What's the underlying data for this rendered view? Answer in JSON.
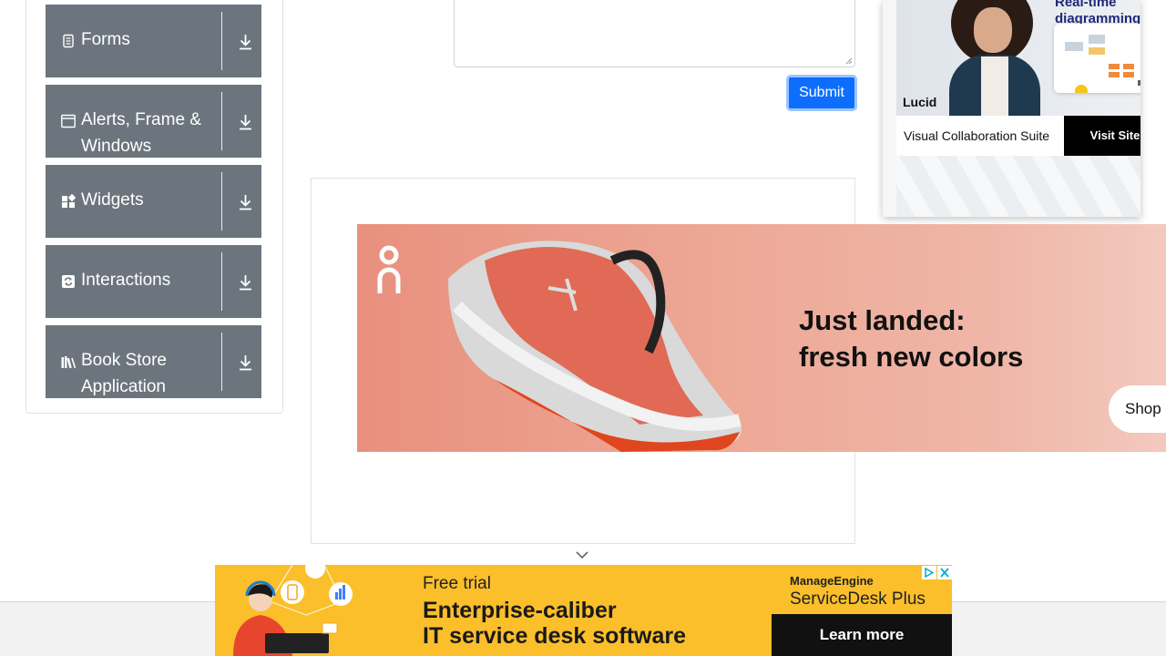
{
  "sidebar": {
    "items": [
      {
        "label": "Forms",
        "icon": "form-icon"
      },
      {
        "label": "Alerts, Frame & Windows",
        "icon": "window-icon"
      },
      {
        "label": "Widgets",
        "icon": "widgets-icon"
      },
      {
        "label": "Interactions",
        "icon": "interactions-icon"
      },
      {
        "label": "Book Store Application",
        "icon": "books-icon"
      }
    ]
  },
  "form": {
    "submit_label": "Submit"
  },
  "ads": {
    "lucid": {
      "headline": "Real-time diagramming",
      "logo": "Lucid",
      "tagline": "Visual Collaboration Suite",
      "cta": "Visit Site"
    },
    "shoe": {
      "headline_line1": "Just landed:",
      "headline_line2": "fresh new colors",
      "cta": "Shop"
    },
    "manageengine": {
      "free_trial": "Free trial",
      "headline_line1": "Enterprise-caliber",
      "headline_line2": "IT service desk software",
      "brand": "ManageEngine",
      "product": "ServiceDesk Plus",
      "cta": "Learn more"
    }
  },
  "colors": {
    "sidebar_item_bg": "#6c757d",
    "submit_bg": "#0d6efd",
    "me_ad_bg": "#fbbf2b"
  }
}
